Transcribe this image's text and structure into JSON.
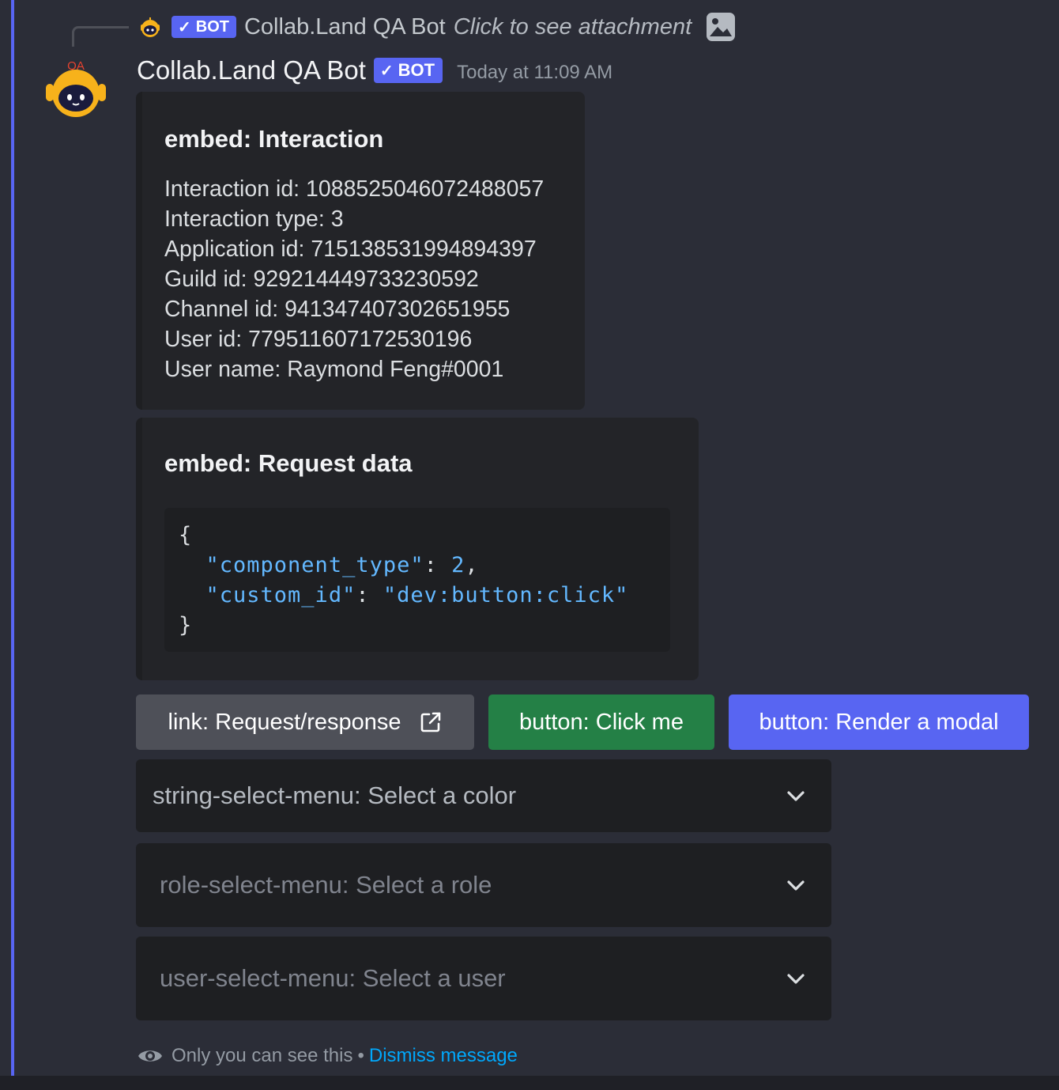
{
  "reply": {
    "badge": "BOT",
    "author": "Collab.Land QA Bot",
    "content": "Click to see attachment",
    "avatar_icon": "robot-avatar-icon",
    "attachment_icon": "image-icon"
  },
  "message": {
    "author": "Collab.Land QA Bot",
    "badge": "BOT",
    "timestamp": "Today at 11:09 AM",
    "avatar_label": "QA"
  },
  "embeds": [
    {
      "title": "embed: Interaction",
      "lines": [
        "Interaction id: 1088525046072488057",
        "Interaction type: 3",
        "Application id: 715138531994894397",
        "Guild id: 929214449733230592",
        "Channel id: 941347407302651955",
        "User id: 779511607172530196",
        "User name: Raymond Feng#0001"
      ]
    },
    {
      "title": "embed: Request data",
      "code": {
        "open": "{",
        "key1": "\"component_type\"",
        "sep1": ": ",
        "val1": "2",
        "comma1": ",",
        "key2": "\"custom_id\"",
        "sep2": ": ",
        "val2": "\"dev:button:click\"",
        "close": "}"
      }
    }
  ],
  "buttons": {
    "link": "link: Request/response",
    "click": "button: Click me",
    "modal": "button: Render a modal"
  },
  "selects": {
    "string": "string-select-menu: Select a color",
    "role": "role-select-menu: Select a role",
    "user": "user-select-menu: Select a user"
  },
  "footer": {
    "only_you": "Only you can see this",
    "dot": "•",
    "dismiss": "Dismiss message"
  },
  "colors": {
    "background": "#2b2d37",
    "brand": "#5865f2",
    "success": "#248046",
    "secondary": "#4e5058",
    "link": "#00a8fc"
  }
}
